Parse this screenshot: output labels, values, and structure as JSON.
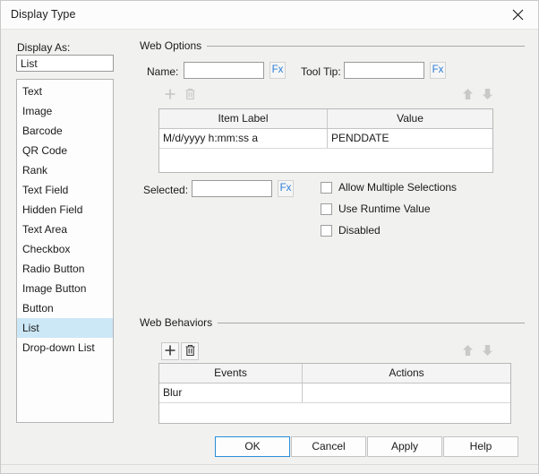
{
  "window": {
    "title": "Display Type",
    "close_icon": "close-icon"
  },
  "left_panel": {
    "label": "Display As:",
    "selected_value": "List",
    "items": [
      {
        "label": "Text",
        "selected": false
      },
      {
        "label": "Image",
        "selected": false
      },
      {
        "label": "Barcode",
        "selected": false
      },
      {
        "label": "QR Code",
        "selected": false
      },
      {
        "label": "Rank",
        "selected": false
      },
      {
        "label": "Text Field",
        "selected": false
      },
      {
        "label": "Hidden Field",
        "selected": false
      },
      {
        "label": "Text Area",
        "selected": false
      },
      {
        "label": "Checkbox",
        "selected": false
      },
      {
        "label": "Radio Button",
        "selected": false
      },
      {
        "label": "Image Button",
        "selected": false
      },
      {
        "label": "Button",
        "selected": false
      },
      {
        "label": "List",
        "selected": true
      },
      {
        "label": "Drop-down List",
        "selected": false
      }
    ]
  },
  "web_options": {
    "title": "Web Options",
    "name_label": "Name:",
    "name_value": "",
    "name_fx_label": "Fx",
    "tooltip_label": "Tool Tip:",
    "tooltip_value": "",
    "tooltip_fx_label": "Fx",
    "toolbar": {
      "add_icon": "plus-icon",
      "delete_icon": "trash-icon",
      "move_up_icon": "arrow-up-icon",
      "move_down_icon": "arrow-down-icon"
    },
    "table": {
      "columns": [
        "Item Label",
        "Value"
      ],
      "rows": [
        [
          "M/d/yyyy h:mm:ss a",
          "PENDDATE"
        ]
      ]
    },
    "selected_label": "Selected:",
    "selected_value": "",
    "selected_fx_label": "Fx",
    "checkboxes": [
      {
        "label": "Allow Multiple Selections",
        "checked": false
      },
      {
        "label": "Use Runtime Value",
        "checked": false
      },
      {
        "label": "Disabled",
        "checked": false
      }
    ]
  },
  "web_behaviors": {
    "title": "Web Behaviors",
    "toolbar": {
      "add_icon": "plus-icon",
      "delete_icon": "trash-icon",
      "move_up_icon": "arrow-up-icon",
      "move_down_icon": "arrow-down-icon"
    },
    "table": {
      "columns": [
        "Events",
        "Actions"
      ],
      "rows": [
        [
          "Blur",
          ""
        ]
      ]
    }
  },
  "footer": {
    "ok": "OK",
    "cancel": "Cancel",
    "apply": "Apply",
    "help": "Help"
  },
  "colors": {
    "accent": "#2a8ed6",
    "selection": "#cce8f6",
    "fx_link": "#2b7dd4",
    "window_bg": "#f1f1f0"
  }
}
